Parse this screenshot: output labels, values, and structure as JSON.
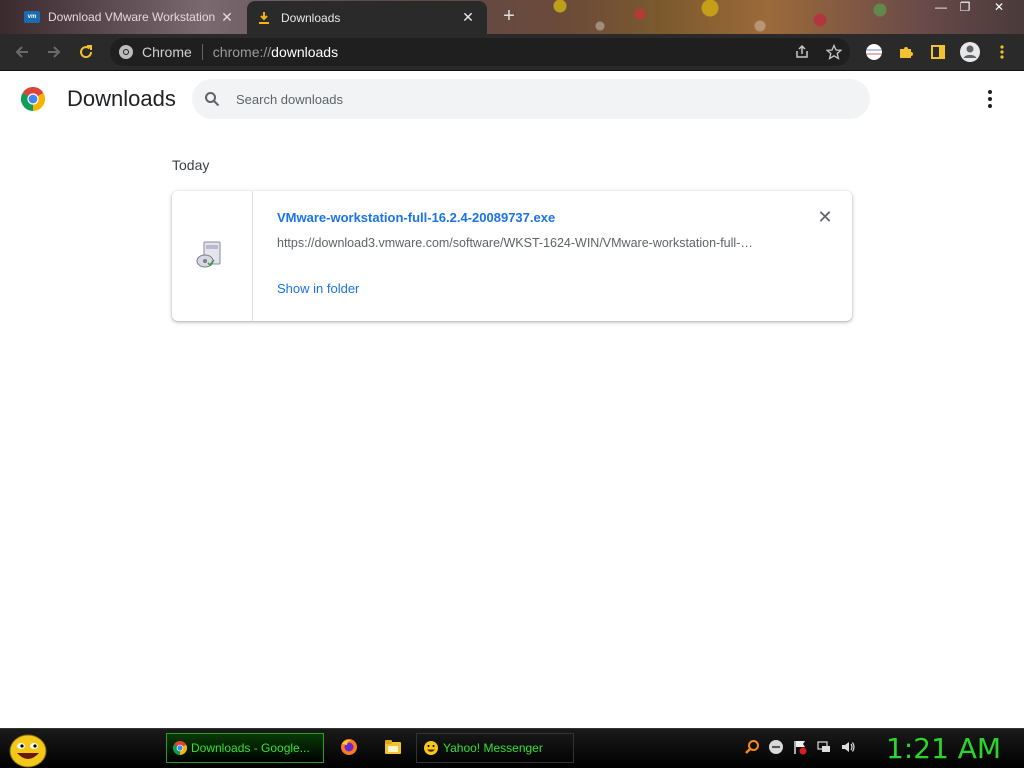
{
  "tabs": [
    {
      "title": "Download VMware Workstation",
      "favicon": "vmware-icon",
      "active": false
    },
    {
      "title": "Downloads",
      "favicon": "download-icon",
      "active": true
    }
  ],
  "omnibox": {
    "site_label": "Chrome",
    "scheme": "chrome://",
    "path": "downloads"
  },
  "page": {
    "title": "Downloads",
    "search_placeholder": "Search downloads",
    "section_date": "Today",
    "items": [
      {
        "filename": "VMware-workstation-full-16.2.4-20089737.exe",
        "url": "https://download3.vmware.com/software/WKST-1624-WIN/VMware-workstation-full-…",
        "action": "Show in folder"
      }
    ]
  },
  "taskbar": {
    "items": [
      {
        "label": "Downloads - Google...",
        "active": true
      },
      {
        "label": "Yahoo! Messenger",
        "active": false
      }
    ],
    "clock": "1:21 AM"
  },
  "colors": {
    "link": "#1a73e8",
    "toolbar_bg": "#2a2a2a",
    "taskbar_text": "#35e035"
  }
}
